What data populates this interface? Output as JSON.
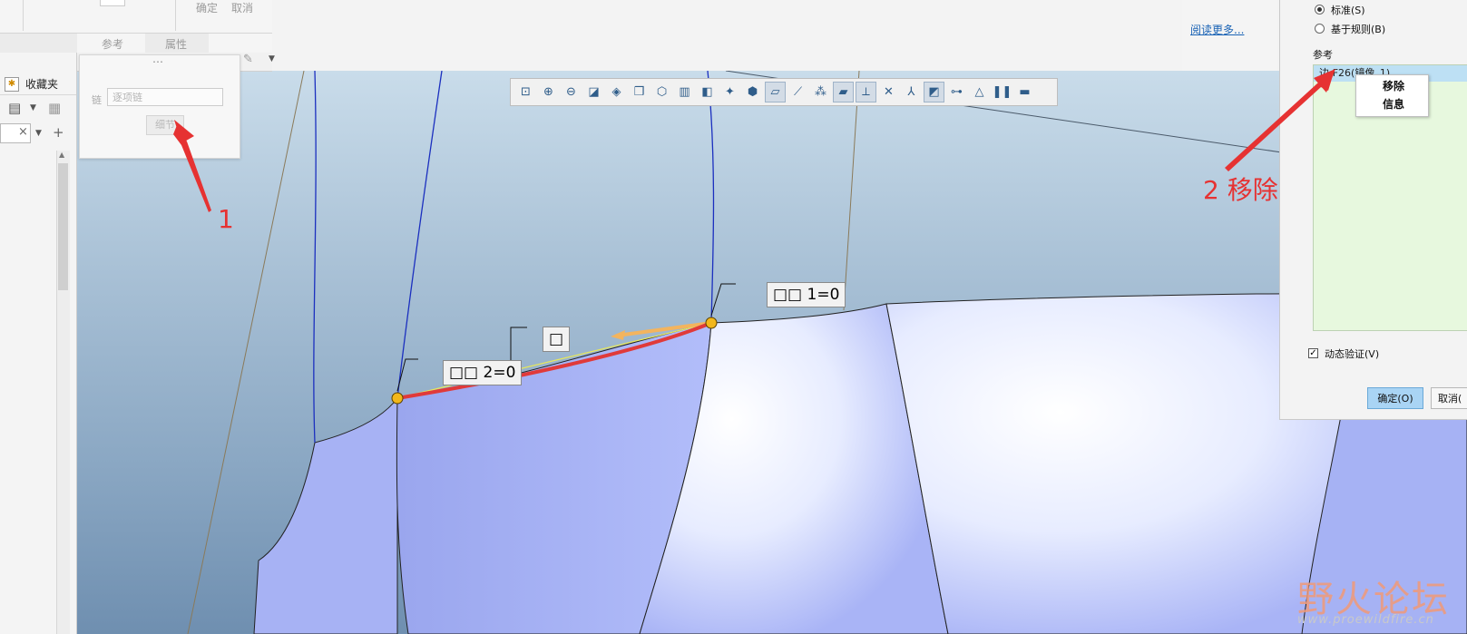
{
  "ribbon": {
    "ok_label": "确定",
    "cancel_label": "取消",
    "tab_refs": "参考",
    "tab_props": "属性"
  },
  "left_panel": {
    "favorites_label": "收藏夹"
  },
  "chain_popup": {
    "grip": "⋯",
    "chain_label": "链",
    "chain_placeholder": "逐项链",
    "details_button": "细节"
  },
  "right_panel": {
    "read_more": "阅读更多...",
    "radio_standard": "标准(S)",
    "radio_rule_based": "基于规则(B)",
    "refs_header": "参考",
    "ref_item": "边:F26(镜像_1)",
    "context_menu": [
      "移除",
      "信息"
    ],
    "dynamic_verify": "动态验证(V)",
    "ok_button": "确定(O)",
    "cancel_button": "取消("
  },
  "viewport_labels": {
    "label_1": "□□ 1=0",
    "label_2": "□□ 2=0",
    "label_mid": "□"
  },
  "annotations": {
    "step1": "1",
    "step2": "2 移除"
  },
  "watermark": {
    "main": "野火论坛",
    "url": "www.proewildfire.cn"
  },
  "colors": {
    "highlight_edge": "#e03a3a",
    "surface": "#aab6f8",
    "annotation": "#e63232",
    "ok_button": "#a9d4f4"
  }
}
